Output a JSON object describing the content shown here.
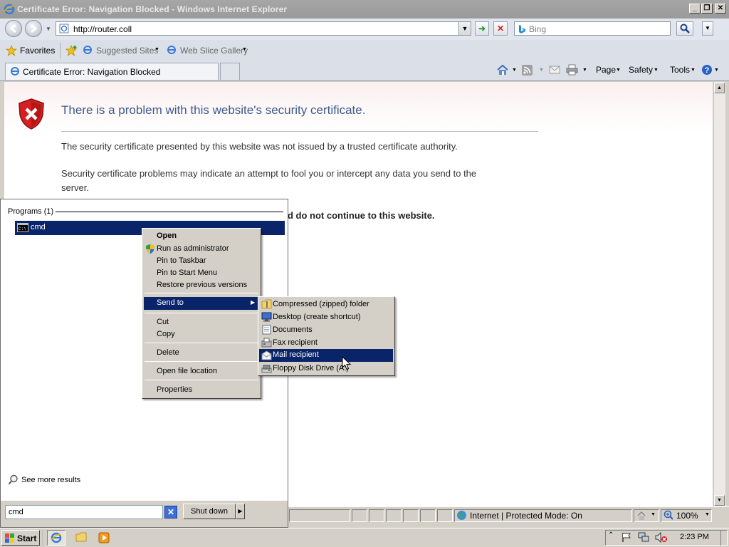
{
  "window": {
    "title": "Certificate Error: Navigation Blocked - Windows Internet Explorer",
    "minimize": "_",
    "maximize": "❐",
    "close": "✕"
  },
  "address_bar": {
    "url": "http://router.coll",
    "search_placeholder": "Bing"
  },
  "favorites_bar": {
    "favorites": "Favorites",
    "items": [
      "Suggested Sites",
      "Web Slice Gallery"
    ]
  },
  "tab": {
    "title": "Certificate Error: Navigation Blocked"
  },
  "command_bar": {
    "page": "Page",
    "safety": "Safety",
    "tools": "Tools"
  },
  "page": {
    "heading": "There is a problem with this website's security certificate.",
    "para1": "The security certificate presented by this website was not issued by a trusted certificate authority.",
    "para2a": "Security certificate problems may indicate an attempt to fool you or intercept any data you send to the",
    "para2b": "server.",
    "bold_fragment": "d do not continue to this website."
  },
  "status_bar": {
    "zone": "Internet | Protected Mode: On",
    "zoom": "100%"
  },
  "start_menu": {
    "programs_header": "Programs (1)",
    "program": "cmd",
    "see_more": "See more results",
    "search_value": "cmd",
    "shutdown": "Shut down"
  },
  "context_menu": {
    "open": "Open",
    "run_as_admin": "Run as administrator",
    "pin_taskbar": "Pin to Taskbar",
    "pin_start": "Pin to Start Menu",
    "restore": "Restore previous versions",
    "send_to": "Send to",
    "cut": "Cut",
    "copy": "Copy",
    "delete": "Delete",
    "open_location": "Open file location",
    "properties": "Properties"
  },
  "send_to_menu": {
    "items": [
      "Compressed (zipped) folder",
      "Desktop (create shortcut)",
      "Documents",
      "Fax recipient",
      "Mail recipient",
      "Floppy Disk Drive (A:)"
    ]
  },
  "taskbar": {
    "start": "Start",
    "clock": "2:23 PM"
  },
  "colors": {
    "highlight": "#0a246a",
    "heading": "#3d5a8c",
    "chrome": "#d4d0c8"
  }
}
